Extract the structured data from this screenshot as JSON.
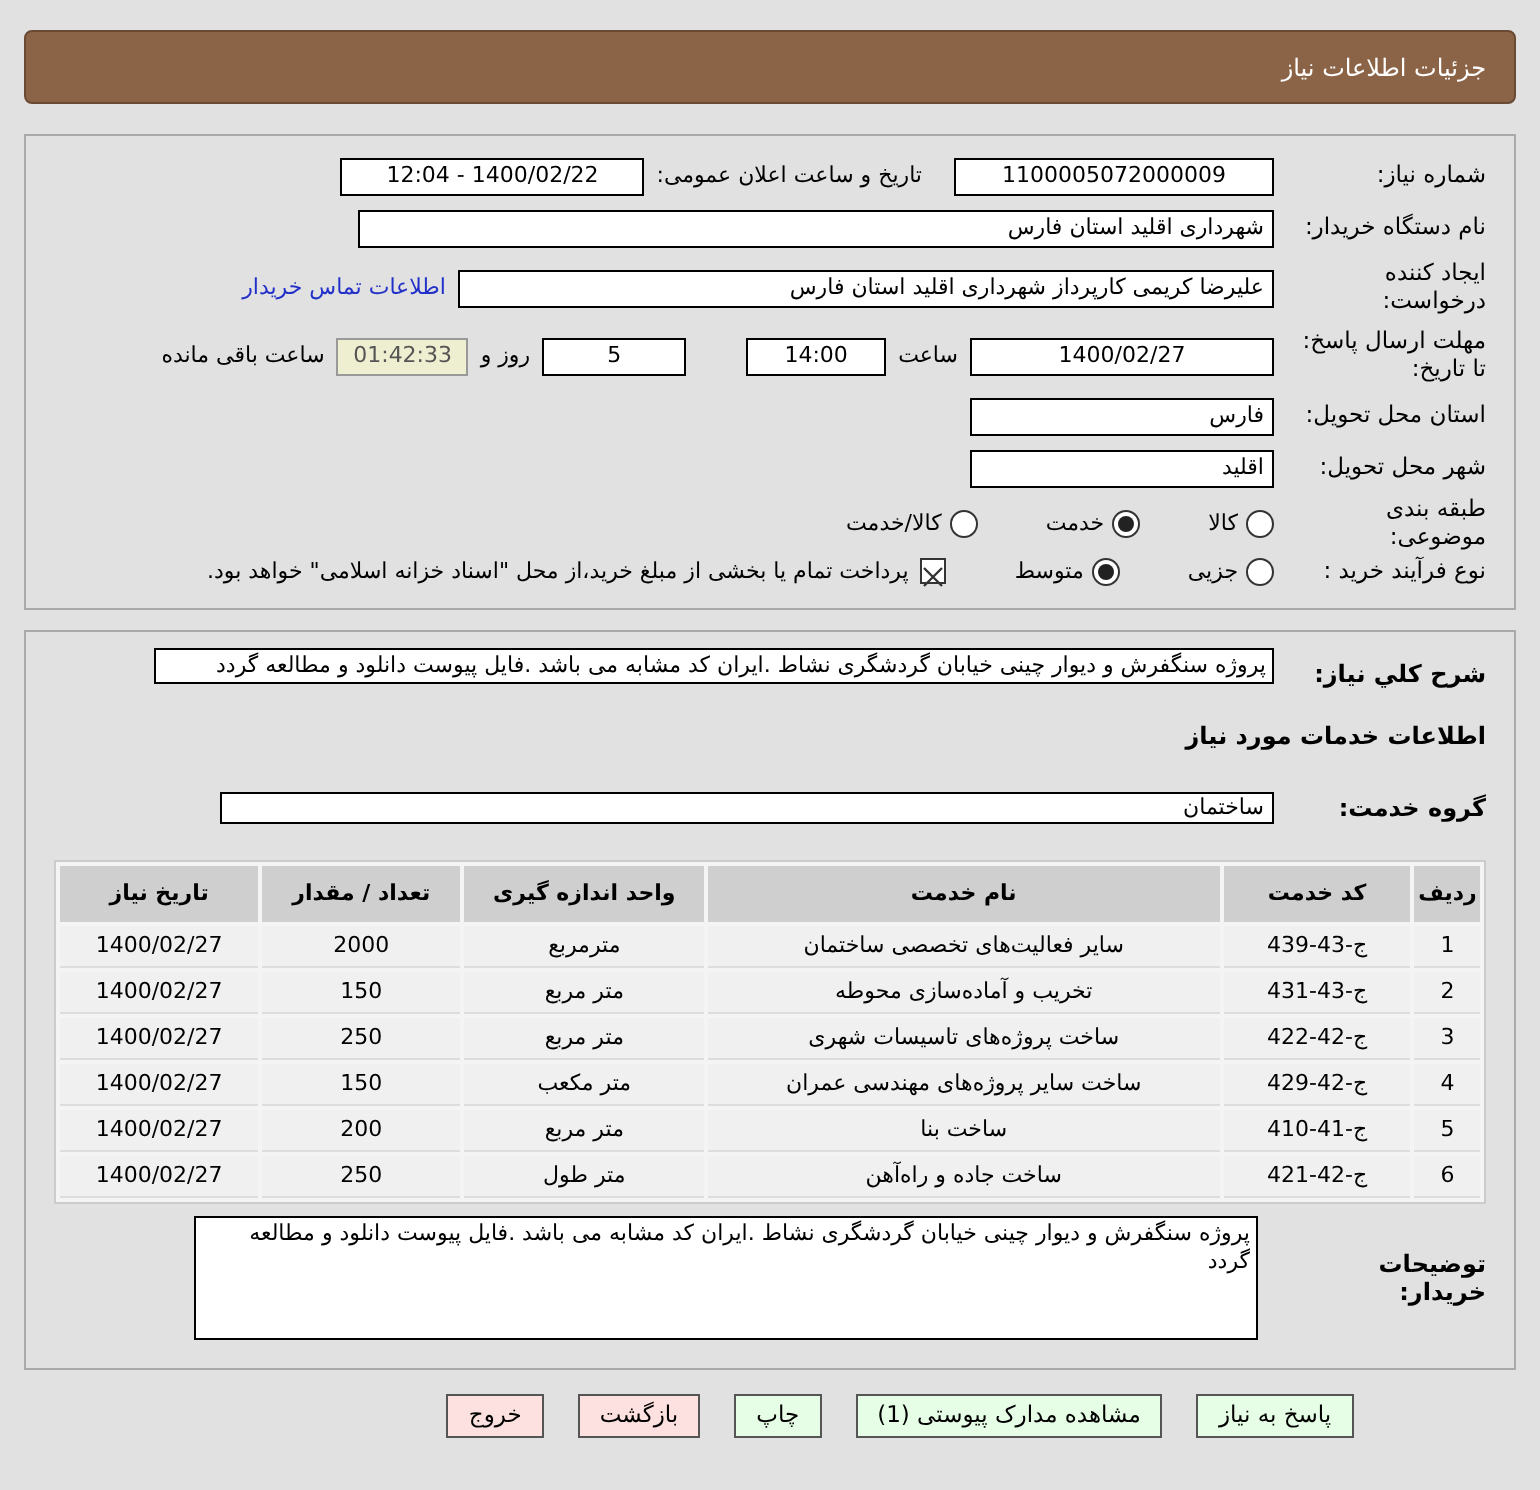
{
  "header": {
    "title": "جزئیات اطلاعات نیاز"
  },
  "need_number": {
    "label": "شماره نیاز:",
    "value": "1100005072000009"
  },
  "announce": {
    "label": "تاریخ و ساعت اعلان عمومی:",
    "value": "1400/02/22 - 12:04"
  },
  "buyer_org": {
    "label": "نام دستگاه خریدار:",
    "value": "شهرداری اقلید استان فارس"
  },
  "creator": {
    "label": "ایجاد کننده درخواست:",
    "value": "علیرضا کریمی  کارپرداز شهرداری اقلید استان فارس",
    "link": "اطلاعات تماس خریدار"
  },
  "deadline": {
    "label": "مهلت ارسال پاسخ: تا تاریخ:",
    "date": "1400/02/27",
    "time_label": "ساعت",
    "time": "14:00",
    "days": "5",
    "days_label": "روز و",
    "remaining": "01:42:33",
    "remaining_label": "ساعت باقی مانده"
  },
  "province": {
    "label": "استان محل تحویل:",
    "value": "فارس"
  },
  "city": {
    "label": "شهر محل تحویل:",
    "value": "اقلید"
  },
  "category": {
    "label": "طبقه بندی موضوعی:",
    "options": [
      {
        "label": "کالا",
        "selected": false
      },
      {
        "label": "خدمت",
        "selected": true
      },
      {
        "label": "کالا/خدمت",
        "selected": false
      }
    ]
  },
  "process": {
    "label": "نوع فرآیند خرید :",
    "options": [
      {
        "label": "جزیی",
        "selected": false
      },
      {
        "label": "متوسط",
        "selected": true
      }
    ],
    "payment": {
      "checked": true,
      "text": "پرداخت تمام یا بخشی از مبلغ خرید،از محل \"اسناد خزانه اسلامی\" خواهد بود."
    }
  },
  "description": {
    "label": "شرح کلي نياز:",
    "text": "پروژه سنگفرش و دیوار چینی خیابان گردشگری نشاط .ایران کد مشابه می باشد .فایل پیوست دانلود و مطالعه گردد"
  },
  "services_title": "اطلاعات خدمات مورد نیاز",
  "service_group": {
    "label": "گروه خدمت:",
    "value": "ساختمان"
  },
  "table": {
    "columns": [
      "ردیف",
      "کد خدمت",
      "نام خدمت",
      "واحد اندازه گیری",
      "تعداد / مقدار",
      "تاریخ نیاز"
    ],
    "rows": [
      [
        "1",
        "ج-43-439",
        "سایر فعالیت‌های تخصصی ساختمان",
        "مترمربع",
        "2000",
        "1400/02/27"
      ],
      [
        "2",
        "ج-43-431",
        "تخریب و آماده‌سازی محوطه",
        "متر مربع",
        "150",
        "1400/02/27"
      ],
      [
        "3",
        "ج-42-422",
        "ساخت پروژه‌های تاسیسات شهری",
        "متر مربع",
        "250",
        "1400/02/27"
      ],
      [
        "4",
        "ج-42-429",
        "ساخت سایر پروژه‌های مهندسی عمران",
        "متر مکعب",
        "150",
        "1400/02/27"
      ],
      [
        "5",
        "ج-41-410",
        "ساخت بنا",
        "متر مربع",
        "200",
        "1400/02/27"
      ],
      [
        "6",
        "ج-42-421",
        "ساخت جاده و راه‌آهن",
        "متر طول",
        "250",
        "1400/02/27"
      ]
    ]
  },
  "buyer_notes": {
    "label": "توضیحات خریدار:",
    "text": "پروژه سنگفرش و دیوار چینی خیابان گردشگری نشاط .ایران کد مشابه می باشد .فایل پیوست دانلود و مطالعه گردد"
  },
  "buttons": [
    {
      "label": "پاسخ به نیاز",
      "kind": "action"
    },
    {
      "label": "مشاهده مدارک پیوستی (1)",
      "kind": "action"
    },
    {
      "label": "چاپ",
      "kind": "action"
    },
    {
      "label": "بازگشت",
      "kind": "exit"
    },
    {
      "label": "خروج",
      "kind": "exit"
    }
  ]
}
